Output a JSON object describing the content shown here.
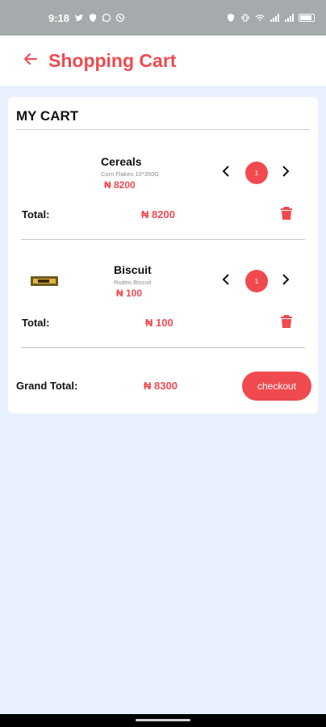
{
  "status_bar": {
    "time": "9:18"
  },
  "header": {
    "title": "Shopping Cart",
    "back_icon": "arrow-left-icon"
  },
  "cart": {
    "title": "MY CART",
    "items": [
      {
        "name": "Cereals",
        "description": "Corn Flakes 10*350G",
        "price": "₦ 8200",
        "quantity": "1",
        "total_label": "Total:",
        "total_value": "₦ 8200"
      },
      {
        "name": "Biscuit",
        "description": "Rodeo Biscuit",
        "price": "₦ 100",
        "quantity": "1",
        "total_label": "Total:",
        "total_value": "₦ 100"
      }
    ],
    "grand_total_label": "Grand Total:",
    "grand_total_value": "₦ 8300",
    "checkout_label": "checkout"
  },
  "colors": {
    "accent": "#f04a4f",
    "background": "#e8f1fd",
    "status_bar": "#a5aaad"
  }
}
